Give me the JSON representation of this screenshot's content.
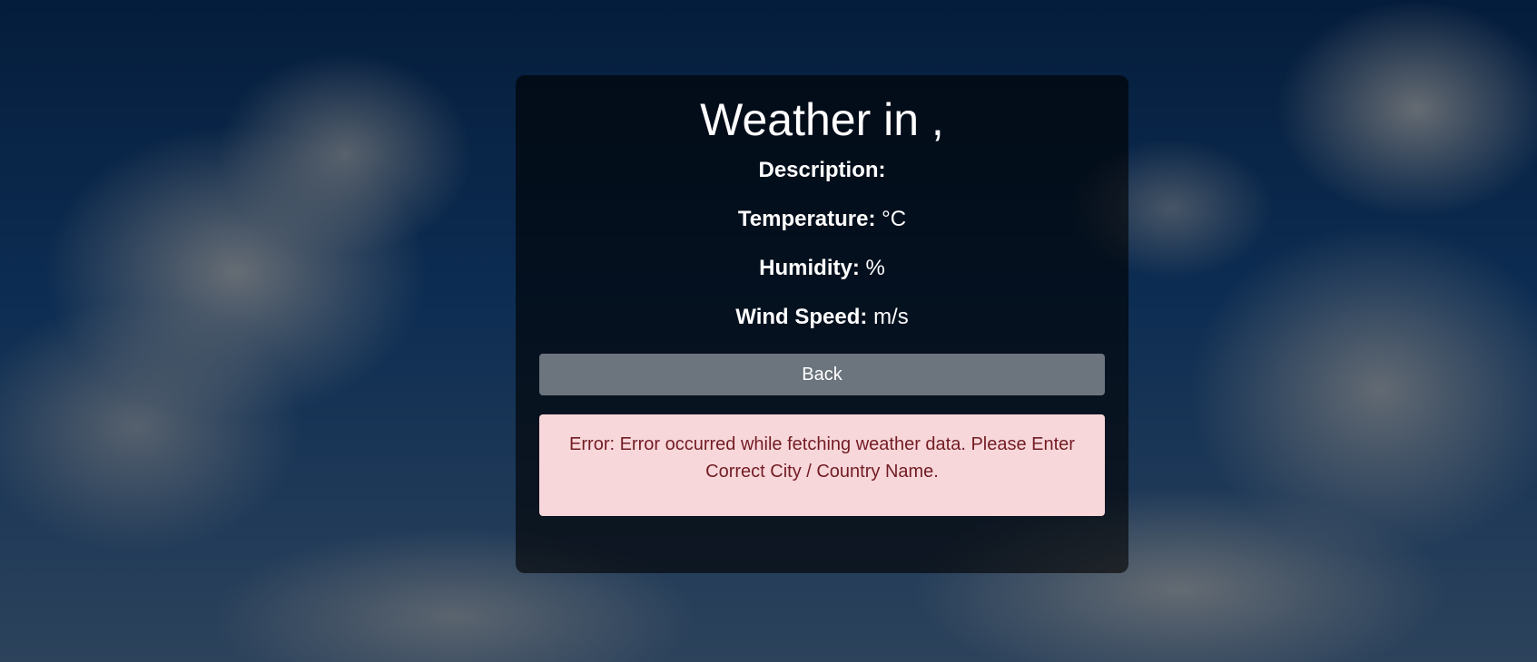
{
  "title": "Weather in ,",
  "fields": {
    "description_label": "Description:",
    "description_value": "",
    "temperature_label": "Temperature:",
    "temperature_value": "°C",
    "humidity_label": "Humidity:",
    "humidity_value": "%",
    "wind_label": "Wind Speed:",
    "wind_value": "m/s"
  },
  "back_label": "Back",
  "error": "Error: Error occurred while fetching weather data. Please Enter Correct City / Country Name.",
  "colors": {
    "button": "#6c757d",
    "error_bg": "#f8d7da",
    "error_text": "#721c24"
  }
}
